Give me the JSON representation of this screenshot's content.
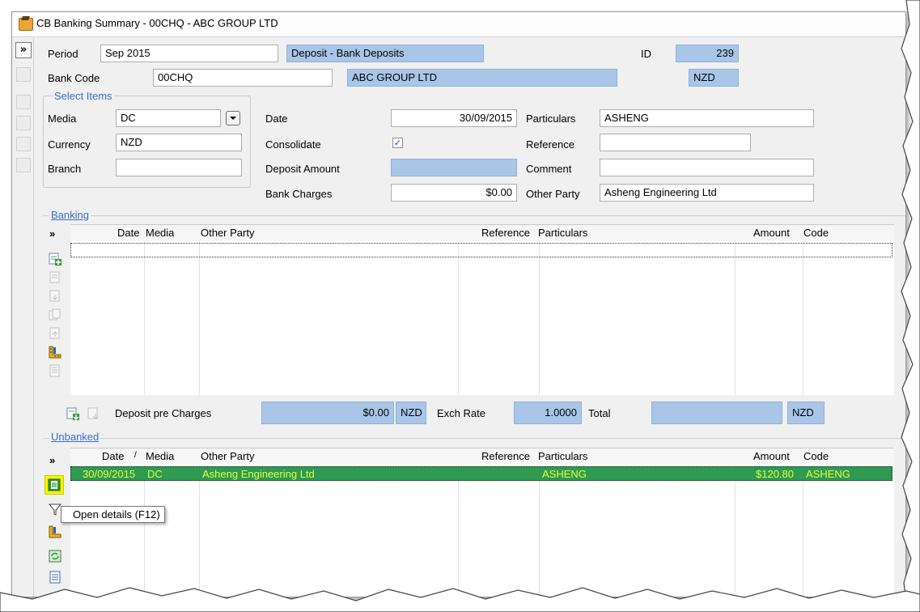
{
  "window": {
    "title": "CB Banking Summary - 00CHQ - ABC GROUP LTD"
  },
  "header": {
    "period_label": "Period",
    "period_value": "Sep 2015",
    "deposit_type": "Deposit - Bank Deposits",
    "id_label": "ID",
    "id_value": "239",
    "bank_code_label": "Bank Code",
    "bank_code_value": "00CHQ",
    "bank_name": "ABC GROUP LTD",
    "currency_code": "NZD"
  },
  "select_items": {
    "legend": "Select Items",
    "media_label": "Media",
    "media_value": "DC",
    "currency_label": "Currency",
    "currency_value": "NZD",
    "branch_label": "Branch",
    "branch_value": ""
  },
  "deposit": {
    "date_label": "Date",
    "date_value": "30/09/2015",
    "consolidate_label": "Consolidate",
    "consolidate_checked": true,
    "deposit_amount_label": "Deposit Amount",
    "deposit_amount_value": "",
    "bank_charges_label": "Bank Charges",
    "bank_charges_value": "$0.00",
    "particulars_label": "Particulars",
    "particulars_value": "ASHENG",
    "reference_label": "Reference",
    "reference_value": "",
    "comment_label": "Comment",
    "comment_value": "",
    "other_party_label": "Other Party",
    "other_party_value": "Asheng Engineering Ltd"
  },
  "banking": {
    "legend": "Banking",
    "expand_glyph": "»",
    "columns": [
      "Date",
      "Media",
      "Other Party",
      "Reference",
      "Particulars",
      "Amount",
      "Code"
    ],
    "rows": []
  },
  "summary": {
    "deposit_pre_charges_label": "Deposit pre Charges",
    "deposit_pre_charges_value": "$0.00",
    "deposit_currency": "NZD",
    "exch_rate_label": "Exch Rate",
    "exch_rate_value": "1.0000",
    "total_label": "Total",
    "total_value": "",
    "total_currency": "NZD"
  },
  "unbanked": {
    "legend": "Unbanked",
    "expand_glyph": "»",
    "columns": [
      "Date",
      "Media",
      "Other Party",
      "Reference",
      "Particulars",
      "Amount",
      "Code"
    ],
    "sort_glyph": "/",
    "rows": [
      {
        "date": "30/09/2015",
        "media": "DC",
        "other_party": "Asheng Engineering Ltd",
        "reference": "",
        "particulars": "ASHENG",
        "amount": "$120.80",
        "code": "ASHENG"
      }
    ]
  },
  "tooltip": {
    "text": "Open details (F12)"
  },
  "toolbar": {
    "expand_glyph": "»"
  },
  "colors": {
    "readonly_fill": "#a9c6e8",
    "selected_row": "#2e9a52",
    "selected_text": "#e6ff3c",
    "legend_text": "#3a6cc7"
  }
}
